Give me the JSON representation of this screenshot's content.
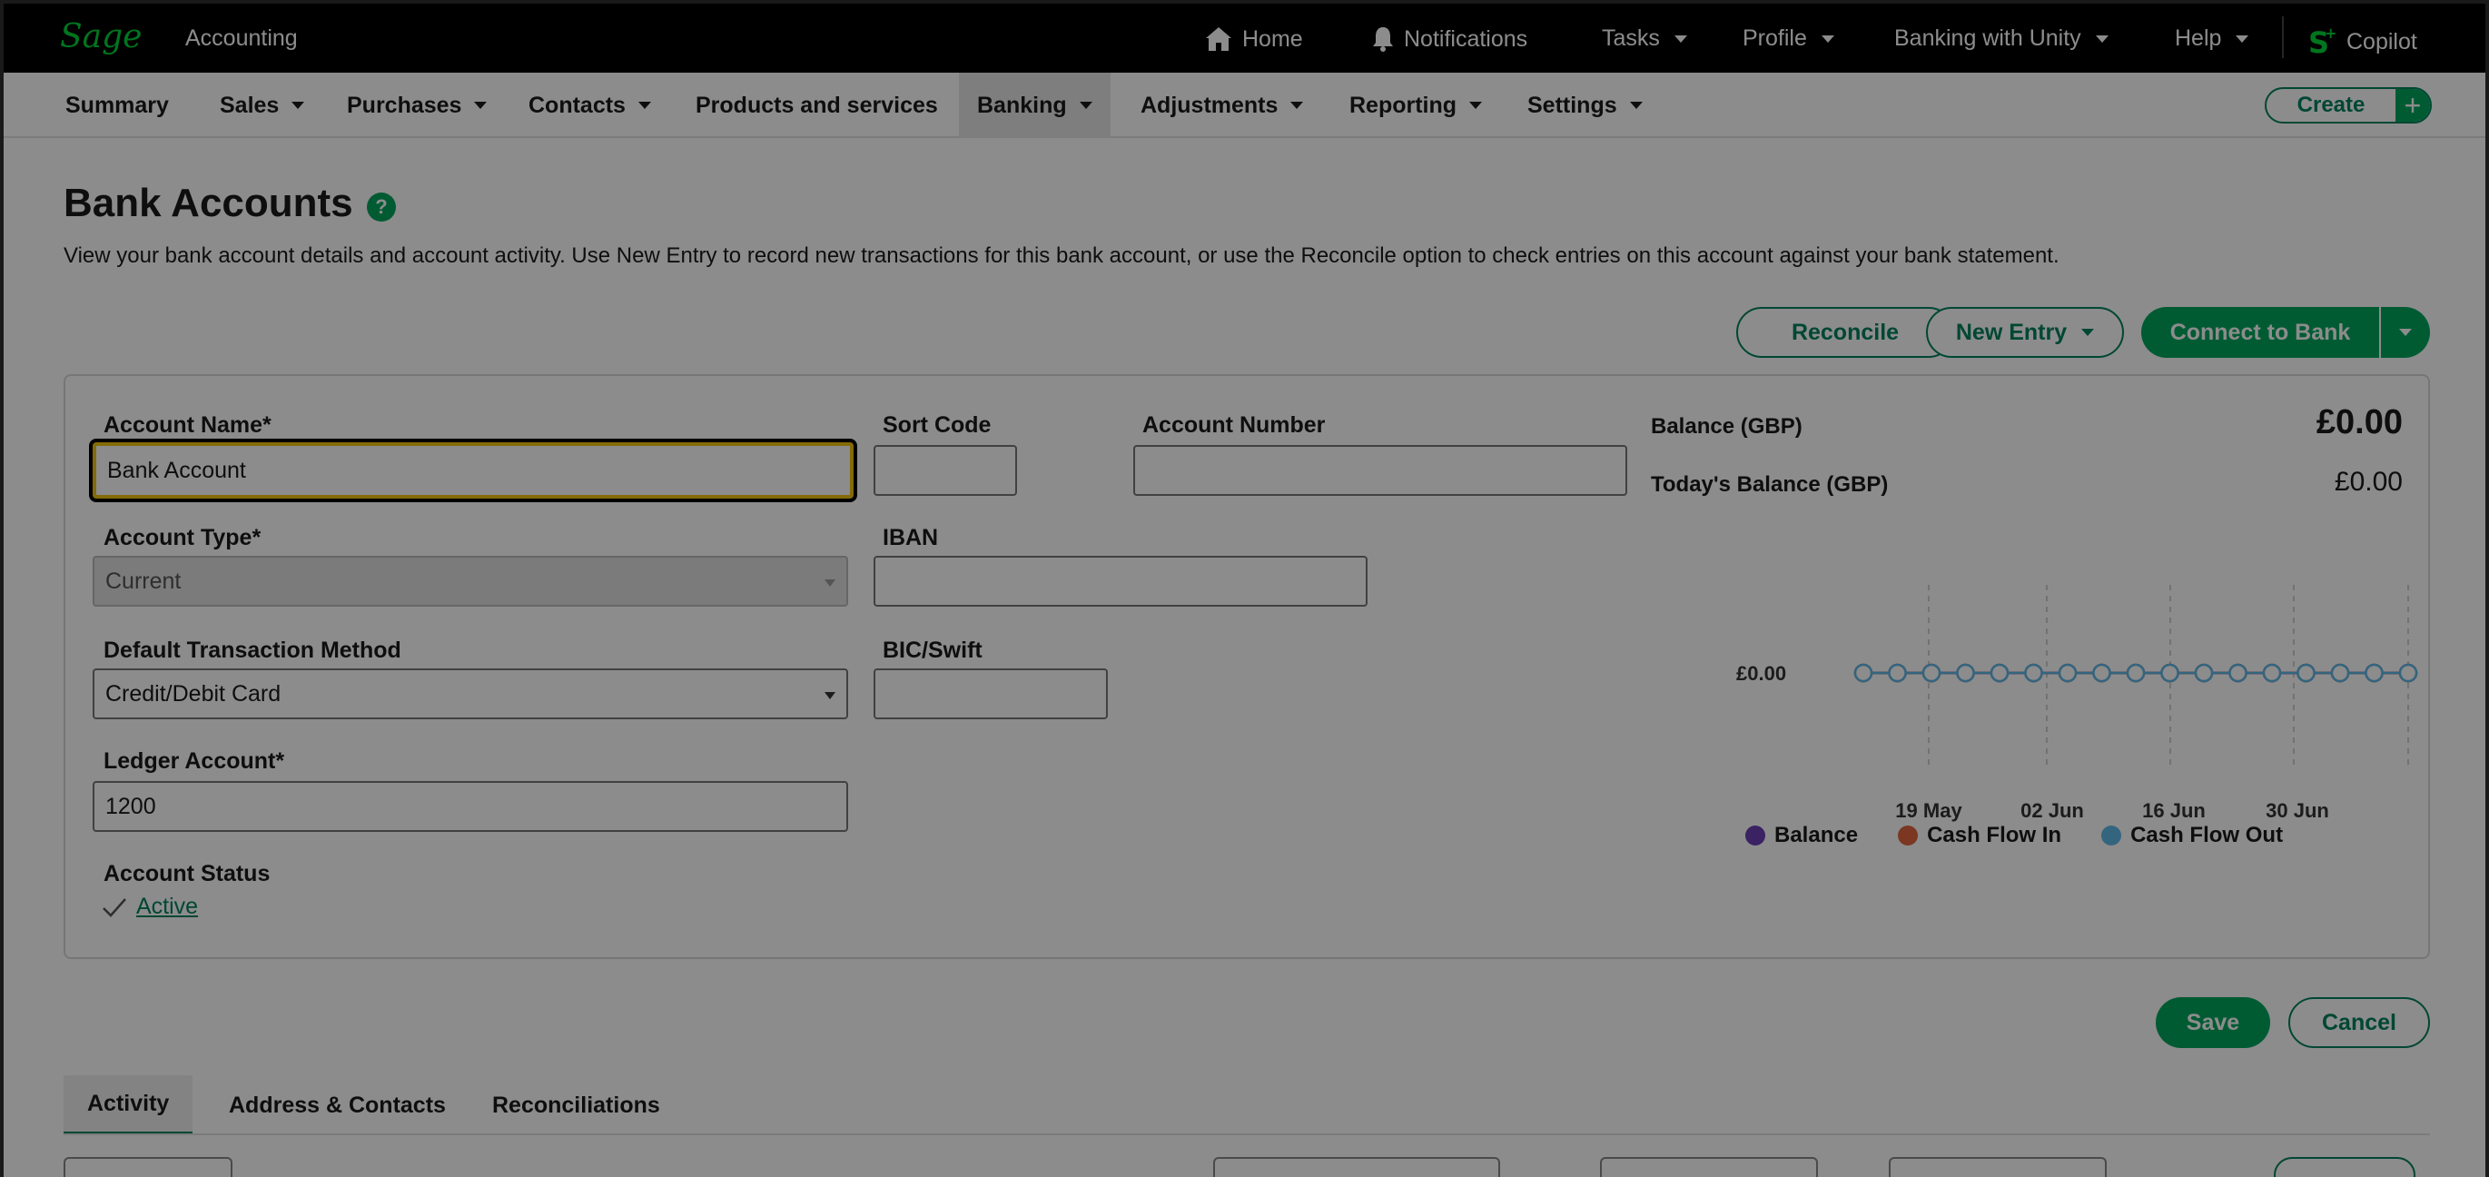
{
  "app": {
    "logo": "Sage",
    "product": "Accounting"
  },
  "topnav": {
    "home": "Home",
    "notifications": "Notifications",
    "tasks": "Tasks",
    "profile": "Profile",
    "banking_unity": "Banking with Unity",
    "help": "Help",
    "copilot": "Copilot"
  },
  "subnav": {
    "items": [
      "Summary",
      "Sales",
      "Purchases",
      "Contacts",
      "Products and services",
      "Banking",
      "Adjustments",
      "Reporting",
      "Settings"
    ],
    "active": "Banking",
    "create": "Create"
  },
  "page": {
    "title": "Bank Accounts",
    "description": "View your bank account details and account activity. Use New Entry to record new transactions for this bank account, or use the Reconcile option to check entries on this account against your bank statement."
  },
  "actions": {
    "reconcile": "Reconcile",
    "new_entry": "New Entry",
    "connect": "Connect to Bank"
  },
  "form": {
    "account_name_label": "Account Name*",
    "account_name_value": "Bank Account",
    "sort_code_label": "Sort Code",
    "sort_code_value": "",
    "account_number_label": "Account Number",
    "account_number_value": "",
    "account_type_label": "Account Type*",
    "account_type_value": "Current",
    "iban_label": "IBAN",
    "iban_value": "",
    "method_label": "Default Transaction Method",
    "method_value": "Credit/Debit Card",
    "bic_label": "BIC/Swift",
    "bic_value": "",
    "ledger_label": "Ledger Account*",
    "ledger_value": "1200",
    "status_label": "Account Status",
    "status_value": "Active"
  },
  "balance": {
    "balance_label": "Balance (GBP)",
    "balance_value": "£0.00",
    "today_label": "Today's Balance (GBP)",
    "today_value": "£0.00"
  },
  "chart_data": {
    "type": "line",
    "x_ticks": [
      "19 May",
      "02 Jun",
      "16 Jun",
      "30 Jun"
    ],
    "y_ticks": [
      "£0.00"
    ],
    "series": [
      {
        "name": "Balance",
        "color": "#6a3fb5",
        "values": [
          0,
          0,
          0,
          0,
          0,
          0,
          0,
          0,
          0,
          0,
          0,
          0,
          0,
          0,
          0,
          0,
          0
        ]
      },
      {
        "name": "Cash Flow In",
        "color": "#e0643c",
        "values": [
          0,
          0,
          0,
          0,
          0,
          0,
          0,
          0,
          0,
          0,
          0,
          0,
          0,
          0,
          0,
          0,
          0
        ]
      },
      {
        "name": "Cash Flow Out",
        "color": "#5fb8e8",
        "values": [
          0,
          0,
          0,
          0,
          0,
          0,
          0,
          0,
          0,
          0,
          0,
          0,
          0,
          0,
          0,
          0,
          0
        ]
      }
    ]
  },
  "buttons": {
    "save": "Save",
    "cancel": "Cancel"
  },
  "tabs": [
    "Activity",
    "Address & Contacts",
    "Reconciliations"
  ],
  "colors": {
    "brand": "#00815d",
    "accent": "#00a65e",
    "focus": "#f1c40f"
  }
}
